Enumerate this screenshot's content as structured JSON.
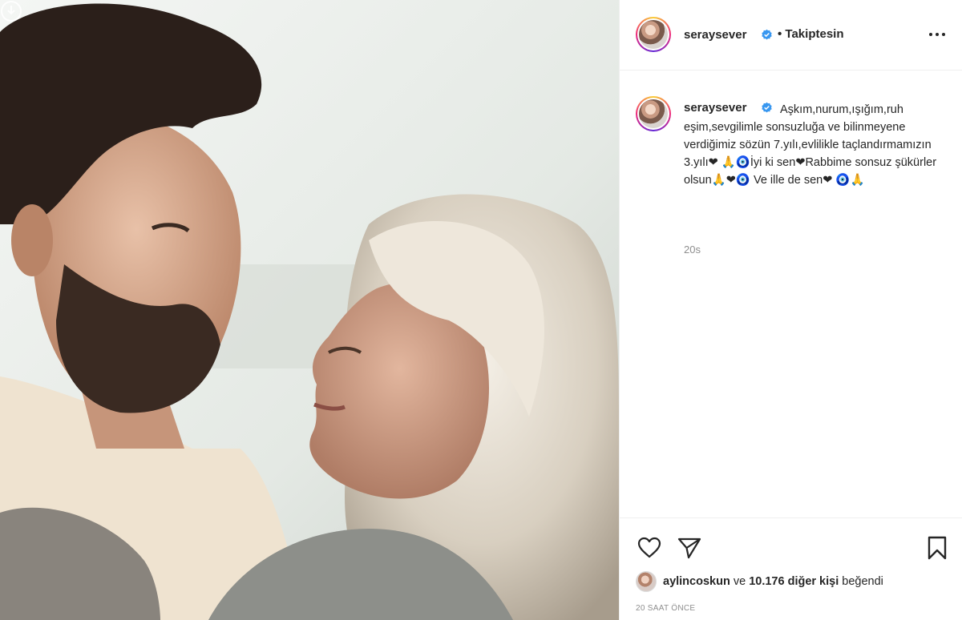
{
  "post": {
    "author": "seraysever",
    "follow_status": "• Takiptesin",
    "caption": "Aşkım,nurum,ışığım,ruh eşim,sevgilimle sonsuzluğa ve bilinmeyene verdiğimiz sözün 7.yılı,evlilikle taçlandırmamızın 3.yılı❤ 🙏🧿İyi ki sen❤Rabbime sonsuz şükürler olsun🙏❤🧿 Ve ille de sen❤ 🧿🙏",
    "caption_timestamp": "20s",
    "likes": {
      "first_liker": "aylincoskun",
      "connector": "ve",
      "others": "10.176 diğer kişi",
      "suffix": "beğendi"
    },
    "time_ago": "20 SAAT ÖNCE"
  },
  "icons": {
    "more": "more-horizontal-icon",
    "like": "heart-icon",
    "share": "paper-plane-icon",
    "save": "bookmark-icon",
    "verified": "verified-badge-icon"
  },
  "colors": {
    "verified": "#3897f0",
    "secondary_text": "#8e8e8e",
    "border": "#efefef"
  }
}
